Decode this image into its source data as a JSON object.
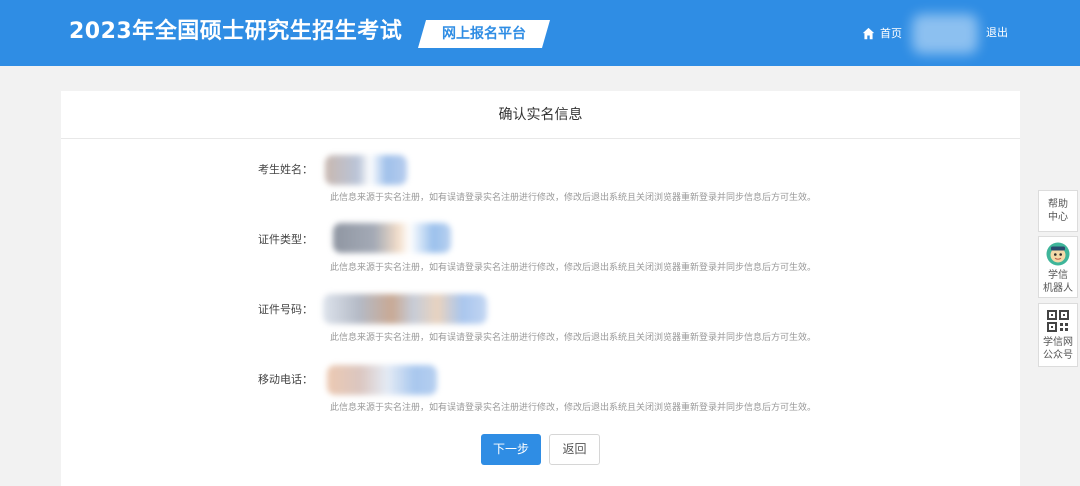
{
  "header": {
    "title": "2023年全国硕士研究生招生考试",
    "badge": "网上报名平台",
    "home_link": "首页",
    "logout_link": "退出"
  },
  "card": {
    "title": "确认实名信息",
    "note": "此信息来源于实名注册，如有误请登录实名注册进行修改，修改后退出系统且关闭浏览器重新登录并同步信息后方可生效。",
    "fields": [
      {
        "label": "考生姓名："
      },
      {
        "label": "证件类型："
      },
      {
        "label": "证件号码："
      },
      {
        "label": "移动电话："
      }
    ],
    "next_button": "下一步",
    "back_button": "返回"
  },
  "side": {
    "help": [
      "帮助",
      "中心"
    ],
    "robot": [
      "学信",
      "机器人"
    ],
    "wechat": [
      "学信网",
      "公众号"
    ]
  },
  "colors": {
    "primary": "#2f8de4",
    "page_bg": "#f2f2f2",
    "note_text": "#999999"
  }
}
